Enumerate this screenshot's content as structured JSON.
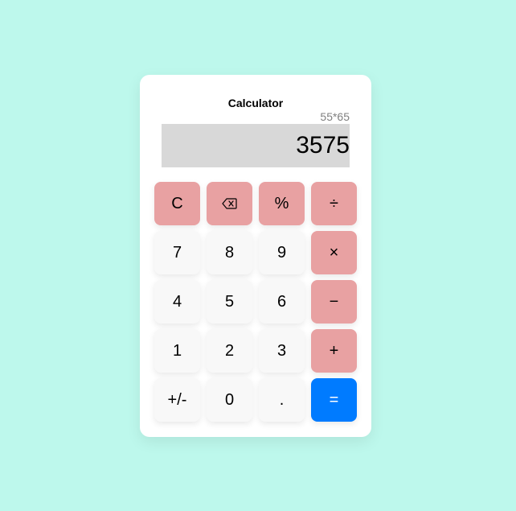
{
  "calculator": {
    "title": "Calculator",
    "expression": "55*65",
    "display_value": "3575"
  },
  "colors": {
    "page_background": "#bdf8ec",
    "card_background": "#ffffff",
    "display_background": "#d8d8d8",
    "operator_key": "#e8a1a2",
    "digit_key": "#f8f8f8",
    "equals_key": "#007bff"
  },
  "keys": {
    "clear": "C",
    "backspace_icon": "backspace-icon",
    "percent": "%",
    "divide": "÷",
    "seven": "7",
    "eight": "8",
    "nine": "9",
    "multiply": "×",
    "four": "4",
    "five": "5",
    "six": "6",
    "subtract": "−",
    "one": "1",
    "two": "2",
    "three": "3",
    "add": "+",
    "negate": "+/-",
    "zero": "0",
    "decimal": ".",
    "equals": "="
  }
}
